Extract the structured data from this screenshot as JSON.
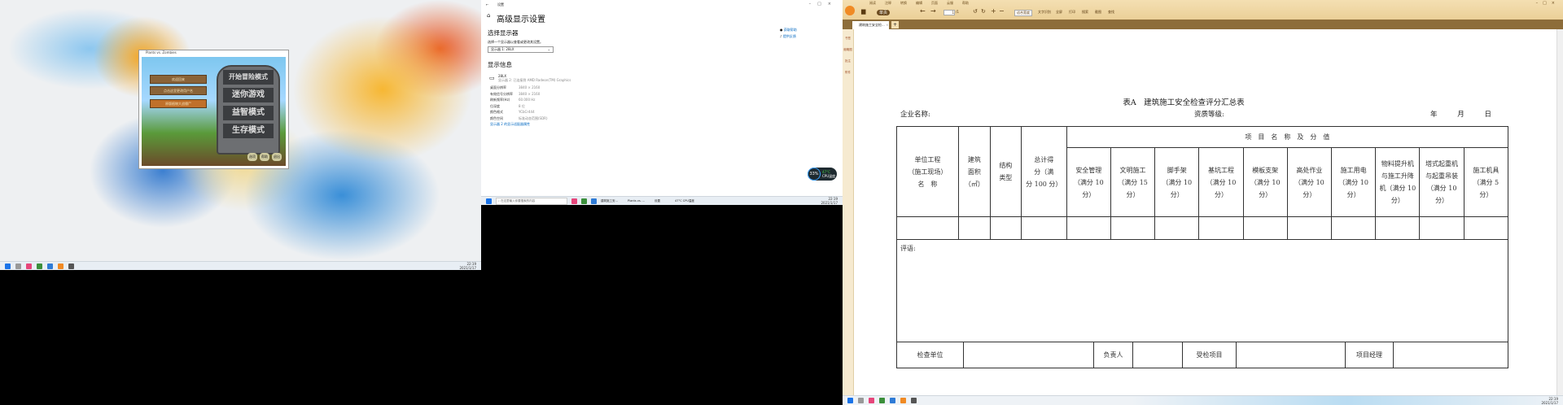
{
  "left_monitor": {
    "game": {
      "title": "Plants vs. Zombies",
      "menu": [
        "开始冒险模式",
        "迷你游戏",
        "益智模式",
        "生存模式"
      ],
      "signs": [
        "欢迎回来",
        "点击这里更改用户名",
        "原版植物大战僵尸"
      ],
      "bags": [
        "选项",
        "帮助",
        "退出"
      ]
    },
    "taskbar": {
      "time": "22:19",
      "date": "2021/1/17"
    }
  },
  "middle_monitor": {
    "window_title": "设置",
    "page_title": "高级显示设置",
    "select_display_heading": "选择显示器",
    "select_display_label": "选择一个显示器以查看或更改其设置。",
    "display_dropdown": "显示器 1: 28LX",
    "info_heading": "显示信息",
    "monitor_name": "28LX",
    "monitor_sub": "显示器 2: 已连接到 AMD Radeon(TM) Graphics",
    "info": [
      {
        "k": "桌面分辨率",
        "v": "3840 × 2160"
      },
      {
        "k": "有效信号分辨率",
        "v": "3840 × 2160"
      },
      {
        "k": "刷新频率(Hz)",
        "v": "60.000 Hz"
      },
      {
        "k": "位深度",
        "v": "8 位"
      },
      {
        "k": "颜色格式",
        "v": "YCbCr444"
      },
      {
        "k": "颜色空间",
        "v": "标准动态范围(SDR)"
      }
    ],
    "adapter_link": "显示器 2 的显示适配器属性",
    "help_links": [
      "获取帮助",
      "提供反馈"
    ],
    "perf_badge": {
      "value": "33%",
      "label": "CPU温度",
      "temp": "47°C"
    },
    "taskbar": {
      "search_placeholder": "在这里输入你要搜索的内容",
      "apps": [
        "建筑施工安...",
        "Plants vs. ...",
        "设置"
      ],
      "weather": "47°C CPU温度",
      "time": "22:19",
      "date": "2021/1/17"
    }
  },
  "right_monitor": {
    "menu": [
      "阅读",
      "注释",
      "转换",
      "编辑",
      "页面",
      "云服",
      "帮助"
    ],
    "toolbar": {
      "open": "打开",
      "single": "单页",
      "page_input": "1",
      "page_total": "/1",
      "zoom": "适合宽度",
      "tools": [
        "文字识别",
        "全屏",
        "打印",
        "搜索",
        "截图",
        "查找"
      ]
    },
    "tab_title": "建筑施工安全检...",
    "sidebar": [
      "书签",
      "缩略图",
      "批注",
      "附件"
    ],
    "document": {
      "title": "表A　建筑施工安全检查评分汇总表",
      "company_label": "企业名称:",
      "qualification_label": "资质等级:",
      "date_labels": [
        "年",
        "月",
        "日"
      ],
      "group_header": "项　目　名　称　及　分　值",
      "fixed_headers": [
        "单位工程\n（施工现场）\n名　称",
        "建筑\n面积\n（㎡）",
        "结构\n类型",
        "总计得\n分（满\n分 100 分）"
      ],
      "item_headers": [
        "安全管理\n（满分 10\n分）",
        "文明施工\n（满分 15\n分）",
        "脚手架\n（满分 10\n分）",
        "基坑工程\n（满分 10\n分）",
        "模板支架\n（满分 10\n分）",
        "高处作业\n（满分 10\n分）",
        "施工用电\n（满分 10\n分）",
        "物料提升机\n与施工升降\n机（满分 10\n分）",
        "塔式起重机\n与起重吊装\n（满分 10\n分）",
        "施工机具\n（满分 5\n分）"
      ],
      "comment_label": "评语:",
      "footer": [
        "检查单位",
        "负责人",
        "受检项目",
        "项目经理"
      ]
    },
    "taskbar": {
      "time": "22:19",
      "date": "2021/1/17"
    }
  }
}
